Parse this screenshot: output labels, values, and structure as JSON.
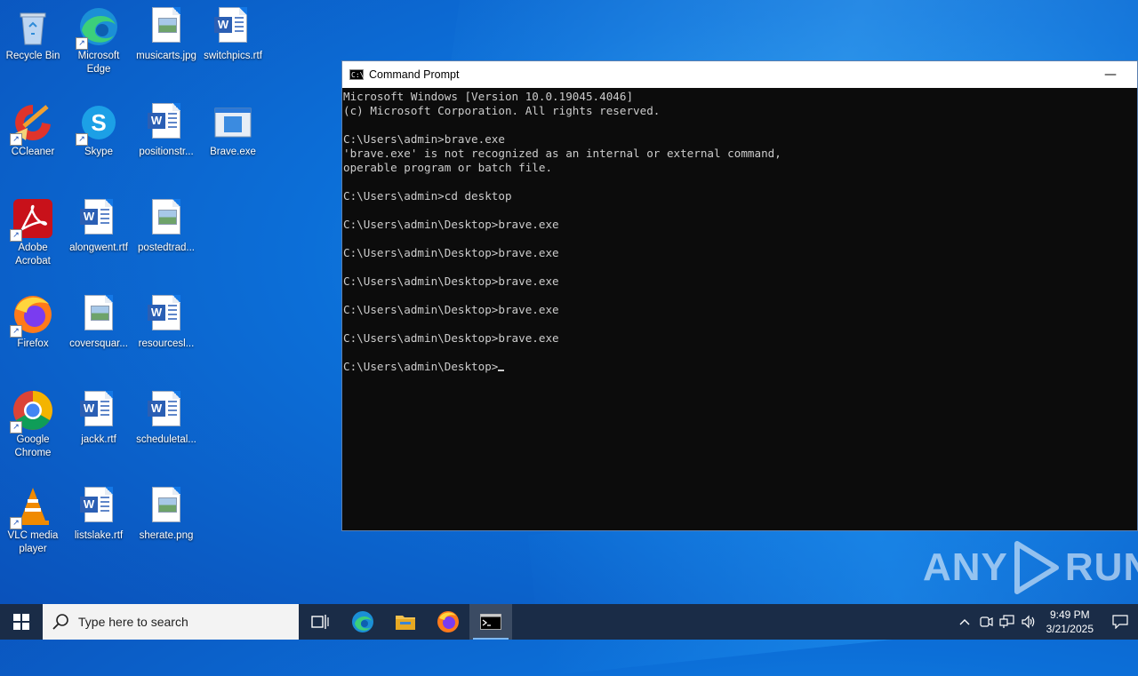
{
  "desktop": {
    "icons": [
      {
        "label": "Recycle Bin",
        "icon": "recycle-bin-icon"
      },
      {
        "label": "Microsoft Edge",
        "icon": "edge-icon"
      },
      {
        "label": "musicarts.jpg",
        "icon": "image-file-icon"
      },
      {
        "label": "switchpics.rtf",
        "icon": "word-doc-icon"
      },
      {
        "label": "CCleaner",
        "icon": "ccleaner-icon"
      },
      {
        "label": "Skype",
        "icon": "skype-icon"
      },
      {
        "label": "positionstr...",
        "icon": "word-doc-icon"
      },
      {
        "label": "Brave.exe",
        "icon": "exe-file-icon"
      },
      {
        "label": "Adobe Acrobat",
        "icon": "acrobat-icon"
      },
      {
        "label": "alongwent.rtf",
        "icon": "word-doc-icon"
      },
      {
        "label": "postedtrad...",
        "icon": "image-file-icon"
      },
      {
        "label": "Firefox",
        "icon": "firefox-icon"
      },
      {
        "label": "coversquar...",
        "icon": "image-file-icon"
      },
      {
        "label": "resourcesl...",
        "icon": "word-doc-icon"
      },
      {
        "label": "Google Chrome",
        "icon": "chrome-icon"
      },
      {
        "label": "jackk.rtf",
        "icon": "word-doc-icon"
      },
      {
        "label": "scheduletal...",
        "icon": "word-doc-icon"
      },
      {
        "label": "VLC media player",
        "icon": "vlc-icon"
      },
      {
        "label": "listslake.rtf",
        "icon": "word-doc-icon"
      },
      {
        "label": "sherate.png",
        "icon": "image-file-icon"
      }
    ]
  },
  "cmd_window": {
    "title": "Command Prompt",
    "minimize_label": "—",
    "lines": [
      "Microsoft Windows [Version 10.0.19045.4046]",
      "(c) Microsoft Corporation. All rights reserved.",
      "",
      "C:\\Users\\admin>brave.exe",
      "'brave.exe' is not recognized as an internal or external command,",
      "operable program or batch file.",
      "",
      "C:\\Users\\admin>cd desktop",
      "",
      "C:\\Users\\admin\\Desktop>brave.exe",
      "",
      "C:\\Users\\admin\\Desktop>brave.exe",
      "",
      "C:\\Users\\admin\\Desktop>brave.exe",
      "",
      "C:\\Users\\admin\\Desktop>brave.exe",
      "",
      "C:\\Users\\admin\\Desktop>brave.exe",
      ""
    ],
    "prompt": "C:\\Users\\admin\\Desktop>"
  },
  "watermark": {
    "left": "ANY",
    "right": "RUN"
  },
  "taskbar": {
    "search_placeholder": "Type here to search",
    "pinned": [
      "task-view-icon",
      "edge-icon",
      "file-explorer-icon",
      "firefox-icon",
      "command-prompt-icon"
    ],
    "tray_icons": [
      "chevron-up-icon",
      "meet-now-icon",
      "network-icon",
      "volume-icon"
    ],
    "time": "9:49 PM",
    "date": "3/21/2025"
  },
  "colors": {
    "taskbar": "#1a2c47",
    "console_bg": "#0c0c0c",
    "console_text": "#cccccc",
    "desktop_blue": "#0c6fd8"
  }
}
